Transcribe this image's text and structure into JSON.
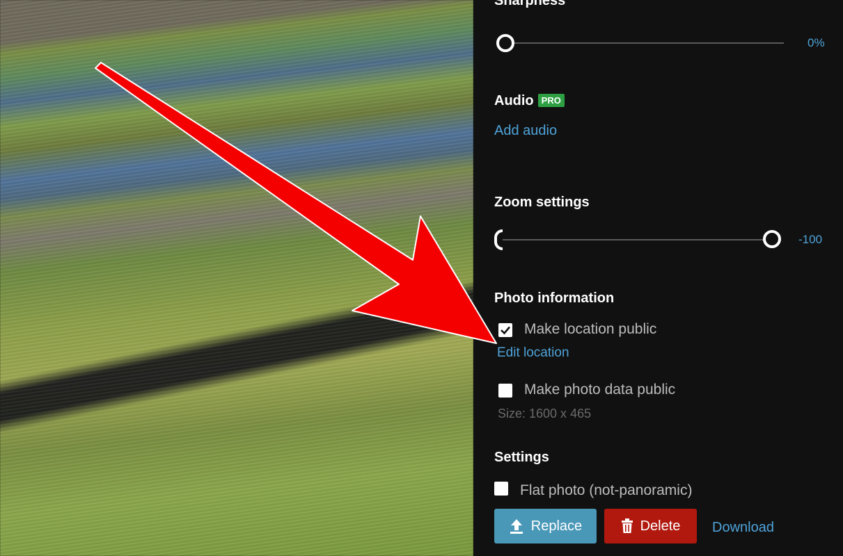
{
  "photo": {
    "icon": "photo-preview"
  },
  "sidebar": {
    "sharpness": {
      "title": "Sharpness",
      "value": "0%",
      "level": 0
    },
    "audio": {
      "title": "Audio",
      "badge": "PRO",
      "add_label": "Add audio"
    },
    "zoom": {
      "title": "Zoom settings",
      "value": "-100",
      "level": 1
    },
    "photo_info": {
      "title": "Photo information",
      "location_label": "Make location public",
      "location_checked": true,
      "edit_location_label": "Edit location",
      "data_label": "Make photo data public",
      "data_checked": false,
      "size_text": "Size: 1600 x 465"
    },
    "settings": {
      "title": "Settings",
      "flat_label": "Flat photo (not-panoramic)",
      "flat_checked": false
    },
    "buttons": {
      "replace_label": "Replace",
      "delete_label": "Delete",
      "download_label": "Download"
    }
  },
  "colors": {
    "accent": "#4fa3d9",
    "pro": "#2ea043",
    "replace": "#4a98b8",
    "delete": "#b1190f",
    "arrow": "#f50000"
  }
}
